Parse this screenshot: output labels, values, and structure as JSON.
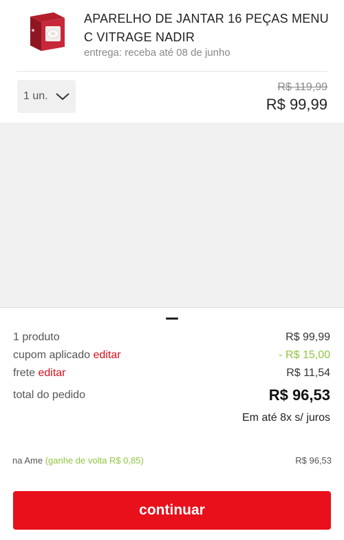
{
  "product": {
    "title": "APARELHO DE JANTAR 16 PEÇAS MENU C VITRAGE NADIR",
    "delivery": "entrega: receba até 08 de junho",
    "image_icon": "dinnerware-box-image"
  },
  "quantity": {
    "selected": "1 un.",
    "icon": "chevron-down-icon"
  },
  "price": {
    "old": "R$ 119,99",
    "current": "R$ 99,99"
  },
  "summary": {
    "items_label": "1 produto",
    "items_value": "R$ 99,99",
    "coupon_label": "cupom aplicado",
    "coupon_edit": "editar",
    "coupon_value": "- R$ 15,00",
    "shipping_label": "frete",
    "shipping_edit": "editar",
    "shipping_value": "R$ 11,54",
    "total_label": "total do pedido",
    "total_value": "R$ 96,53",
    "installments": "Em até 8x s/ juros"
  },
  "ame": {
    "label": "na Ame",
    "cashback": "(ganhe de volta R$ 0,85)",
    "value": "R$ 96,53"
  },
  "actions": {
    "continue_label": "continuar"
  },
  "colors": {
    "brand_red": "#e8101a",
    "link_red": "#d90d19",
    "discount_green": "#8fc640"
  }
}
